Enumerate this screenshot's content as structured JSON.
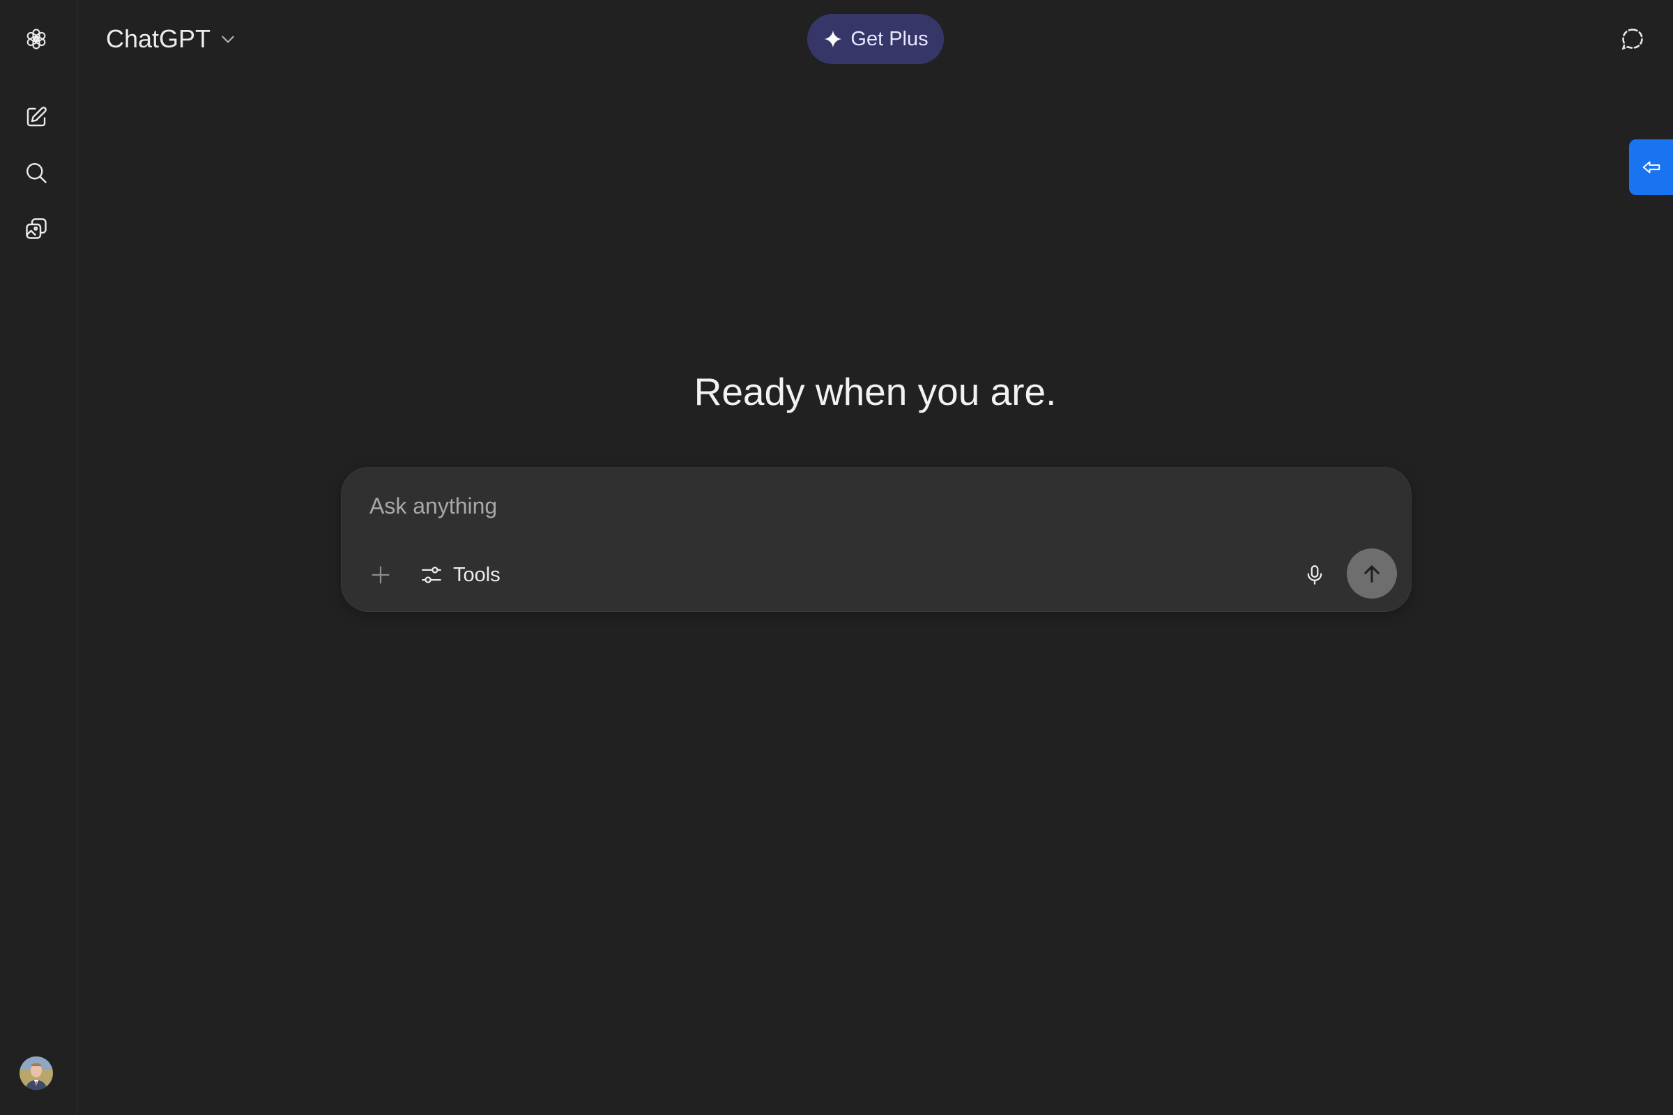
{
  "header": {
    "model_name": "ChatGPT",
    "upgrade_label": "Get Plus"
  },
  "sidebar": {
    "icons": [
      "openai-logo-icon",
      "new-chat-icon",
      "search-icon",
      "library-icon"
    ],
    "avatar": "user-avatar"
  },
  "main": {
    "headline": "Ready when you are."
  },
  "composer": {
    "placeholder": "Ask anything",
    "tools_label": "Tools"
  },
  "colors": {
    "background": "#212121",
    "composer": "#303030",
    "get_plus_bg": "#373669",
    "side_tab": "#1a73f0",
    "send_button": "#6e6e6e"
  }
}
